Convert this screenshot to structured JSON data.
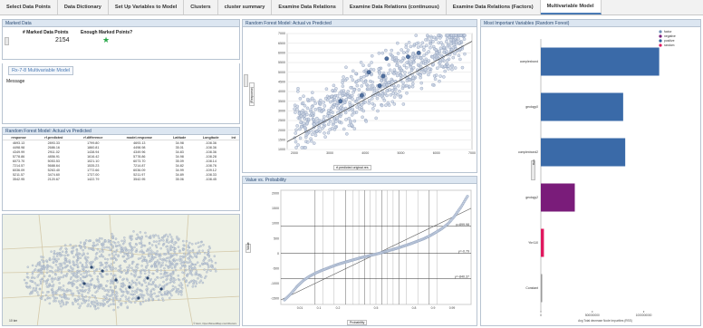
{
  "tabs": [
    {
      "label": "Select Data Points"
    },
    {
      "label": "Data Dictionary"
    },
    {
      "label": "Set Up Variables to Model"
    },
    {
      "label": "Clusters"
    },
    {
      "label": "cluster summary"
    },
    {
      "label": "Examine Data Relations"
    },
    {
      "label": "Examine Data Relations (continuous)"
    },
    {
      "label": "Examine Data Relations (Factors)"
    },
    {
      "label": "Multivariable Model"
    }
  ],
  "marked": {
    "title": "Marked Data",
    "col1": "# Marked Data Points",
    "col2": "Enough Marked Points?",
    "count": "2154"
  },
  "multivariate": {
    "link": "Rx-7-8 Multivariable Model",
    "message_label": "Message"
  },
  "rf_table": {
    "title": "Random Forest Model: Actual vs Predicted",
    "headers": [
      "response",
      "rf.predicted",
      "rf.difference",
      "model.response",
      "Latitude",
      "Longitude",
      "int"
    ],
    "rows": [
      [
        "4693.13",
        "2893.33",
        "1799.80",
        "4693.13",
        "34.98",
        "-108.36",
        ""
      ],
      [
        "4498.98",
        "2686.16",
        "1860.81",
        "4498.98",
        "35.01",
        "-108.36",
        ""
      ],
      [
        "4349.99",
        "2911.02",
        "1438.94",
        "4349.96",
        "34.83",
        "-108.36",
        ""
      ],
      [
        "5778.86",
        "4856.91",
        "1616.42",
        "5778.86",
        "34.98",
        "-108.28",
        ""
      ],
      [
        "6073.70",
        "5053.53",
        "1021.10",
        "6073.70",
        "35.09",
        "-108.14",
        ""
      ],
      [
        "7214.57",
        "5688.64",
        "1535.23",
        "7214.87",
        "34.82",
        "-108.76",
        ""
      ],
      [
        "6036.09",
        "5263.40",
        "1772.66",
        "6036.09",
        "34.99",
        "-109.12",
        ""
      ],
      [
        "5211.57",
        "3474.60",
        "1737.00",
        "5211.97",
        "34.89",
        "-108.33",
        ""
      ],
      [
        "3542.95",
        "2120.67",
        "1422.79",
        "3542.95",
        "35.06",
        "-108.45",
        ""
      ]
    ]
  },
  "map": {
    "attribution": "© Esri, OpenStreetMap contributors",
    "scale": "10 km"
  },
  "scatter": {
    "title": "Random Forest Model: Actual vs Predicted",
    "xaxis_dropdown": "rf.predicted original.res",
    "yaxis_dropdown": "(Response)"
  },
  "qq": {
    "title": "Value vs. Probability",
    "xaxis_dropdown": "Probability",
    "yaxis_dropdown": "Value",
    "labels": [
      "y=899.98",
      "y=-0.79",
      "y=-840.37"
    ]
  },
  "bars": {
    "title": "Most Important Variables (Random Forest)",
    "legend": [
      {
        "name": "factor",
        "color": "#6d8fb5"
      },
      {
        "name": "negative",
        "color": "#7a1c7a"
      },
      {
        "name": "positive",
        "color": "#2f5f9a"
      },
      {
        "name": "random",
        "color": "#e0185e"
      }
    ],
    "xaxis_title": "Avg Total decrease Node Impurities (RSS)",
    "side_label": "Bars"
  },
  "chart_data": [
    {
      "type": "scatter",
      "title": "Random Forest Model: Actual vs Predicted",
      "xlabel": "rf.predicted original.res",
      "ylabel": "(Response)",
      "xlim": [
        1800,
        7000
      ],
      "ylim": [
        1000,
        7000
      ],
      "x_ticks": [
        2000,
        3000,
        4000,
        5000,
        6000,
        7000
      ],
      "y_ticks": [
        1000,
        1500,
        2000,
        2500,
        3000,
        3500,
        4000,
        4500,
        5000,
        5500,
        6000,
        6500,
        7000
      ],
      "trend_line": {
        "from": [
          1800,
          1400
        ],
        "to": [
          7000,
          6600
        ]
      },
      "marked_points": {
        "x": [
          3300,
          3900,
          4100,
          4500,
          4600,
          5200,
          5500,
          4400
        ],
        "y": [
          3500,
          3800,
          5000,
          4800,
          5700,
          5800,
          6000,
          4300
        ]
      }
    },
    {
      "type": "scatter",
      "title": "Value vs. Probability",
      "xlabel": "Probability",
      "ylabel": "Value",
      "ylim": [
        -1700,
        2100
      ],
      "y_ticks": [
        -1500,
        -1000,
        -500,
        0,
        500,
        1000,
        1500,
        2000
      ],
      "x_ticks": [
        "0.01",
        "0.1",
        "0.2",
        "0.5",
        "0.8",
        "0.9",
        "0.99"
      ],
      "reference_lines": [
        899.98,
        -0.79,
        -840.37
      ],
      "quantiles": [
        -1550,
        -1350,
        -1100,
        -900,
        -760,
        -650,
        -560,
        -480,
        -400,
        -330,
        -270,
        -210,
        -150,
        -100,
        -50,
        0,
        60,
        120,
        180,
        250,
        320,
        400,
        480,
        580,
        700,
        830,
        1000,
        1250,
        1550,
        1900
      ]
    },
    {
      "type": "bar",
      "title": "Most Important Variables (Random Forest)",
      "orientation": "horizontal",
      "categories": [
        "complexbond",
        "geology0",
        "complexbond2",
        "geology2",
        "Ytrr110",
        "Constant"
      ],
      "values": [
        1150000000,
        800000000,
        820000000,
        330000000,
        30000000,
        5000000
      ],
      "colors": [
        "#3a6aa8",
        "#3a6aa8",
        "#3a6aa8",
        "#7a1c7a",
        "#e0185e",
        "#9a9a9a"
      ],
      "x_ticks": [
        "0",
        "500000000",
        "1000000000"
      ],
      "xlim": [
        0,
        1250000000
      ],
      "xlabel": "Avg Total decrease Node Impurities (RSS)"
    }
  ]
}
